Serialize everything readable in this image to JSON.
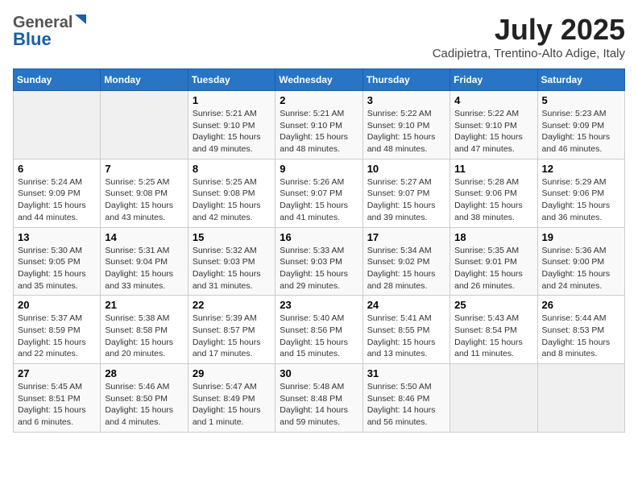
{
  "header": {
    "logo_line1": "General",
    "logo_line2": "Blue",
    "title": "July 2025",
    "subtitle": "Cadipietra, Trentino-Alto Adige, Italy"
  },
  "calendar": {
    "days_of_week": [
      "Sunday",
      "Monday",
      "Tuesday",
      "Wednesday",
      "Thursday",
      "Friday",
      "Saturday"
    ],
    "weeks": [
      [
        {
          "day": "",
          "info": ""
        },
        {
          "day": "",
          "info": ""
        },
        {
          "day": "1",
          "info": "Sunrise: 5:21 AM\nSunset: 9:10 PM\nDaylight: 15 hours\nand 49 minutes."
        },
        {
          "day": "2",
          "info": "Sunrise: 5:21 AM\nSunset: 9:10 PM\nDaylight: 15 hours\nand 48 minutes."
        },
        {
          "day": "3",
          "info": "Sunrise: 5:22 AM\nSunset: 9:10 PM\nDaylight: 15 hours\nand 48 minutes."
        },
        {
          "day": "4",
          "info": "Sunrise: 5:22 AM\nSunset: 9:10 PM\nDaylight: 15 hours\nand 47 minutes."
        },
        {
          "day": "5",
          "info": "Sunrise: 5:23 AM\nSunset: 9:09 PM\nDaylight: 15 hours\nand 46 minutes."
        }
      ],
      [
        {
          "day": "6",
          "info": "Sunrise: 5:24 AM\nSunset: 9:09 PM\nDaylight: 15 hours\nand 44 minutes."
        },
        {
          "day": "7",
          "info": "Sunrise: 5:25 AM\nSunset: 9:08 PM\nDaylight: 15 hours\nand 43 minutes."
        },
        {
          "day": "8",
          "info": "Sunrise: 5:25 AM\nSunset: 9:08 PM\nDaylight: 15 hours\nand 42 minutes."
        },
        {
          "day": "9",
          "info": "Sunrise: 5:26 AM\nSunset: 9:07 PM\nDaylight: 15 hours\nand 41 minutes."
        },
        {
          "day": "10",
          "info": "Sunrise: 5:27 AM\nSunset: 9:07 PM\nDaylight: 15 hours\nand 39 minutes."
        },
        {
          "day": "11",
          "info": "Sunrise: 5:28 AM\nSunset: 9:06 PM\nDaylight: 15 hours\nand 38 minutes."
        },
        {
          "day": "12",
          "info": "Sunrise: 5:29 AM\nSunset: 9:06 PM\nDaylight: 15 hours\nand 36 minutes."
        }
      ],
      [
        {
          "day": "13",
          "info": "Sunrise: 5:30 AM\nSunset: 9:05 PM\nDaylight: 15 hours\nand 35 minutes."
        },
        {
          "day": "14",
          "info": "Sunrise: 5:31 AM\nSunset: 9:04 PM\nDaylight: 15 hours\nand 33 minutes."
        },
        {
          "day": "15",
          "info": "Sunrise: 5:32 AM\nSunset: 9:03 PM\nDaylight: 15 hours\nand 31 minutes."
        },
        {
          "day": "16",
          "info": "Sunrise: 5:33 AM\nSunset: 9:03 PM\nDaylight: 15 hours\nand 29 minutes."
        },
        {
          "day": "17",
          "info": "Sunrise: 5:34 AM\nSunset: 9:02 PM\nDaylight: 15 hours\nand 28 minutes."
        },
        {
          "day": "18",
          "info": "Sunrise: 5:35 AM\nSunset: 9:01 PM\nDaylight: 15 hours\nand 26 minutes."
        },
        {
          "day": "19",
          "info": "Sunrise: 5:36 AM\nSunset: 9:00 PM\nDaylight: 15 hours\nand 24 minutes."
        }
      ],
      [
        {
          "day": "20",
          "info": "Sunrise: 5:37 AM\nSunset: 8:59 PM\nDaylight: 15 hours\nand 22 minutes."
        },
        {
          "day": "21",
          "info": "Sunrise: 5:38 AM\nSunset: 8:58 PM\nDaylight: 15 hours\nand 20 minutes."
        },
        {
          "day": "22",
          "info": "Sunrise: 5:39 AM\nSunset: 8:57 PM\nDaylight: 15 hours\nand 17 minutes."
        },
        {
          "day": "23",
          "info": "Sunrise: 5:40 AM\nSunset: 8:56 PM\nDaylight: 15 hours\nand 15 minutes."
        },
        {
          "day": "24",
          "info": "Sunrise: 5:41 AM\nSunset: 8:55 PM\nDaylight: 15 hours\nand 13 minutes."
        },
        {
          "day": "25",
          "info": "Sunrise: 5:43 AM\nSunset: 8:54 PM\nDaylight: 15 hours\nand 11 minutes."
        },
        {
          "day": "26",
          "info": "Sunrise: 5:44 AM\nSunset: 8:53 PM\nDaylight: 15 hours\nand 8 minutes."
        }
      ],
      [
        {
          "day": "27",
          "info": "Sunrise: 5:45 AM\nSunset: 8:51 PM\nDaylight: 15 hours\nand 6 minutes."
        },
        {
          "day": "28",
          "info": "Sunrise: 5:46 AM\nSunset: 8:50 PM\nDaylight: 15 hours\nand 4 minutes."
        },
        {
          "day": "29",
          "info": "Sunrise: 5:47 AM\nSunset: 8:49 PM\nDaylight: 15 hours\nand 1 minute."
        },
        {
          "day": "30",
          "info": "Sunrise: 5:48 AM\nSunset: 8:48 PM\nDaylight: 14 hours\nand 59 minutes."
        },
        {
          "day": "31",
          "info": "Sunrise: 5:50 AM\nSunset: 8:46 PM\nDaylight: 14 hours\nand 56 minutes."
        },
        {
          "day": "",
          "info": ""
        },
        {
          "day": "",
          "info": ""
        }
      ]
    ]
  }
}
